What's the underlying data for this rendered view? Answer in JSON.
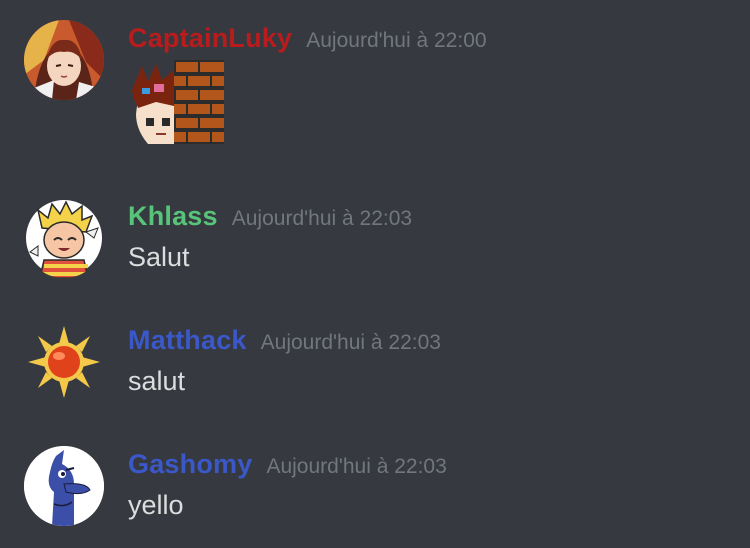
{
  "messages": [
    {
      "username": "CaptainLuky",
      "username_color": "#b91c1c",
      "timestamp": "Aujourd'hui à 22:00",
      "text": "",
      "avatar_icon": "anime-girl-avatar",
      "attachment": "pixel-art-emoji"
    },
    {
      "username": "Khlass",
      "username_color": "#57c47a",
      "timestamp": "Aujourd'hui à 22:03",
      "text": "Salut",
      "avatar_icon": "blonde-boy-avatar"
    },
    {
      "username": "Matthack",
      "username_color": "#3b58c9",
      "timestamp": "Aujourd'hui à 22:03",
      "text": "salut",
      "avatar_icon": "sun-avatar"
    },
    {
      "username": "Gashomy",
      "username_color": "#3b58c9",
      "timestamp": "Aujourd'hui à 22:03",
      "text": "yello",
      "avatar_icon": "blue-bird-avatar"
    }
  ]
}
